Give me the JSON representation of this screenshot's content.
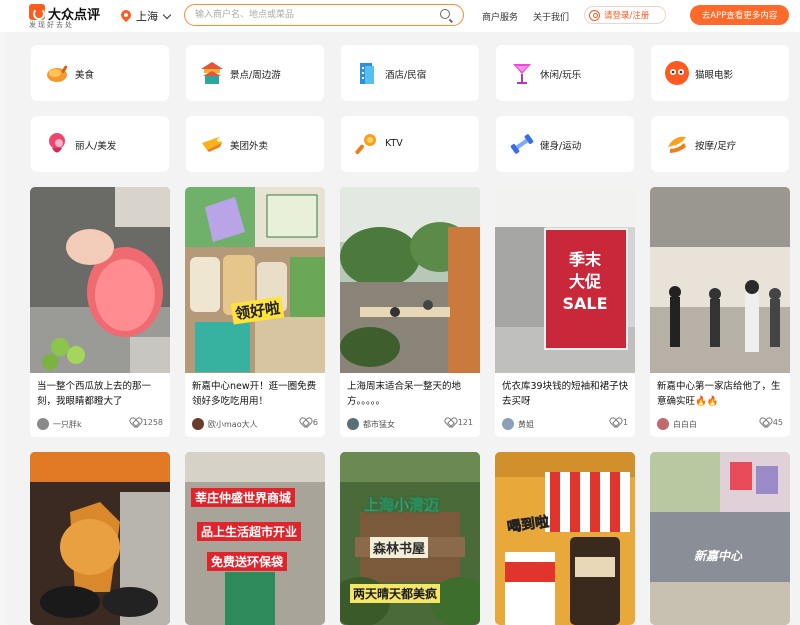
{
  "header": {
    "logo_title": "大众点评",
    "logo_subtitle": "发现好去处",
    "city": "上海",
    "search_placeholder": "输入商户名、地点或菜品",
    "merchant_service": "商户服务",
    "about_us": "关于我们",
    "login": "请登录/注册",
    "app_button": "去APP查看更多内容"
  },
  "categories": [
    {
      "label": "美食",
      "icon": "food-icon"
    },
    {
      "label": "景点/周边游",
      "icon": "attraction-icon"
    },
    {
      "label": "酒店/民宿",
      "icon": "hotel-icon"
    },
    {
      "label": "休闲/玩乐",
      "icon": "leisure-icon"
    },
    {
      "label": "猫眼电影",
      "icon": "maoyan-icon"
    },
    {
      "label": "丽人/美发",
      "icon": "beauty-icon"
    },
    {
      "label": "美团外卖",
      "icon": "delivery-icon"
    },
    {
      "label": "KTV",
      "icon": "ktv-icon"
    },
    {
      "label": "健身/运动",
      "icon": "fitness-icon"
    },
    {
      "label": "按摩/足疗",
      "icon": "massage-icon"
    }
  ],
  "feed": [
    {
      "title": "当一整个西瓜放上去的那一刻，我眼睛都瞪大了",
      "author": "一只胖k",
      "likes": "1258"
    },
    {
      "title": "新嘉中心new开！逛一圈免费领好多吃吃用用！",
      "author": "欧小mao大人",
      "likes": "6",
      "overlay": "领好啦"
    },
    {
      "title": "上海周末适合呆一整天的地方。。。。。",
      "author": "都市猛女",
      "likes": "121"
    },
    {
      "title": "优衣库39块钱的短袖和裙子快去买呀",
      "author": "黄姐",
      "likes": "1",
      "overlay_lines": [
        "季末",
        "大促",
        "SALE"
      ]
    },
    {
      "title": "新嘉中心第一家店给他了，生意确实旺🔥🔥",
      "author": "白白白",
      "likes": "45"
    }
  ],
  "feed_row2": [
    {
      "overlay": ""
    },
    {
      "overlay_lines": [
        "莘庄仲盛世界商城",
        "品上生活超市开业",
        "免费送环保袋"
      ]
    },
    {
      "overlay_lines": [
        "上海小清迈",
        "森林书屋",
        "两天晴天都美疯"
      ]
    },
    {
      "overlay": "喝到啦"
    },
    {
      "overlay": "新嘉中心"
    }
  ],
  "colors": {
    "accent": "#ff5a1f"
  }
}
